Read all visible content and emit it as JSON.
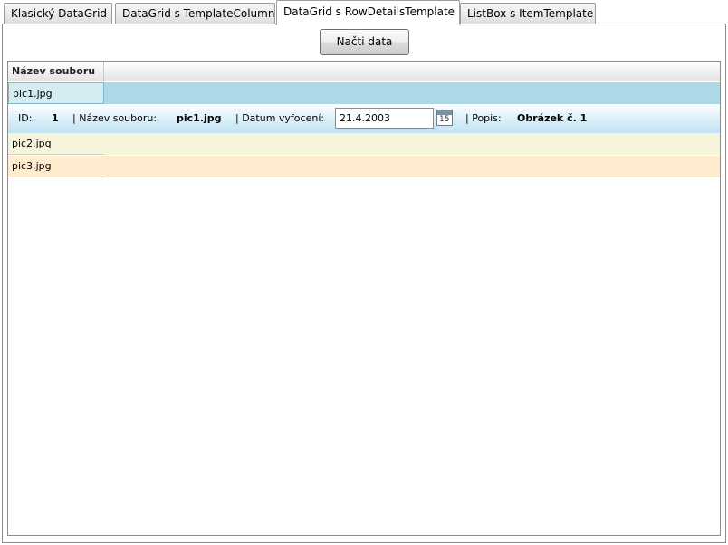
{
  "tabs": [
    {
      "label": "Klasický DataGrid"
    },
    {
      "label": "DataGrid s TemplateColumn"
    },
    {
      "label": "DataGrid s RowDetailsTemplate"
    },
    {
      "label": "ListBox s ItemTemplate"
    }
  ],
  "load_button": {
    "label": "Načti data"
  },
  "grid": {
    "column_header": "Název souboru",
    "rows": [
      {
        "file": "pic1.jpg",
        "color": "#add8e6"
      },
      {
        "file": "pic2.jpg",
        "color": "#f5f5dc"
      },
      {
        "file": "pic3.jpg",
        "color": "#ffebcd"
      }
    ],
    "details": {
      "id_label": "ID:",
      "id_value": "1",
      "name_label": "| Název souboru:",
      "name_value": "pic1.jpg",
      "date_label": "| Datum vyfocení:",
      "date_value": "21.4.2003",
      "calendar_icon_text": "15",
      "desc_label": "| Popis:",
      "desc_value": "Obrázek č. 1"
    }
  }
}
